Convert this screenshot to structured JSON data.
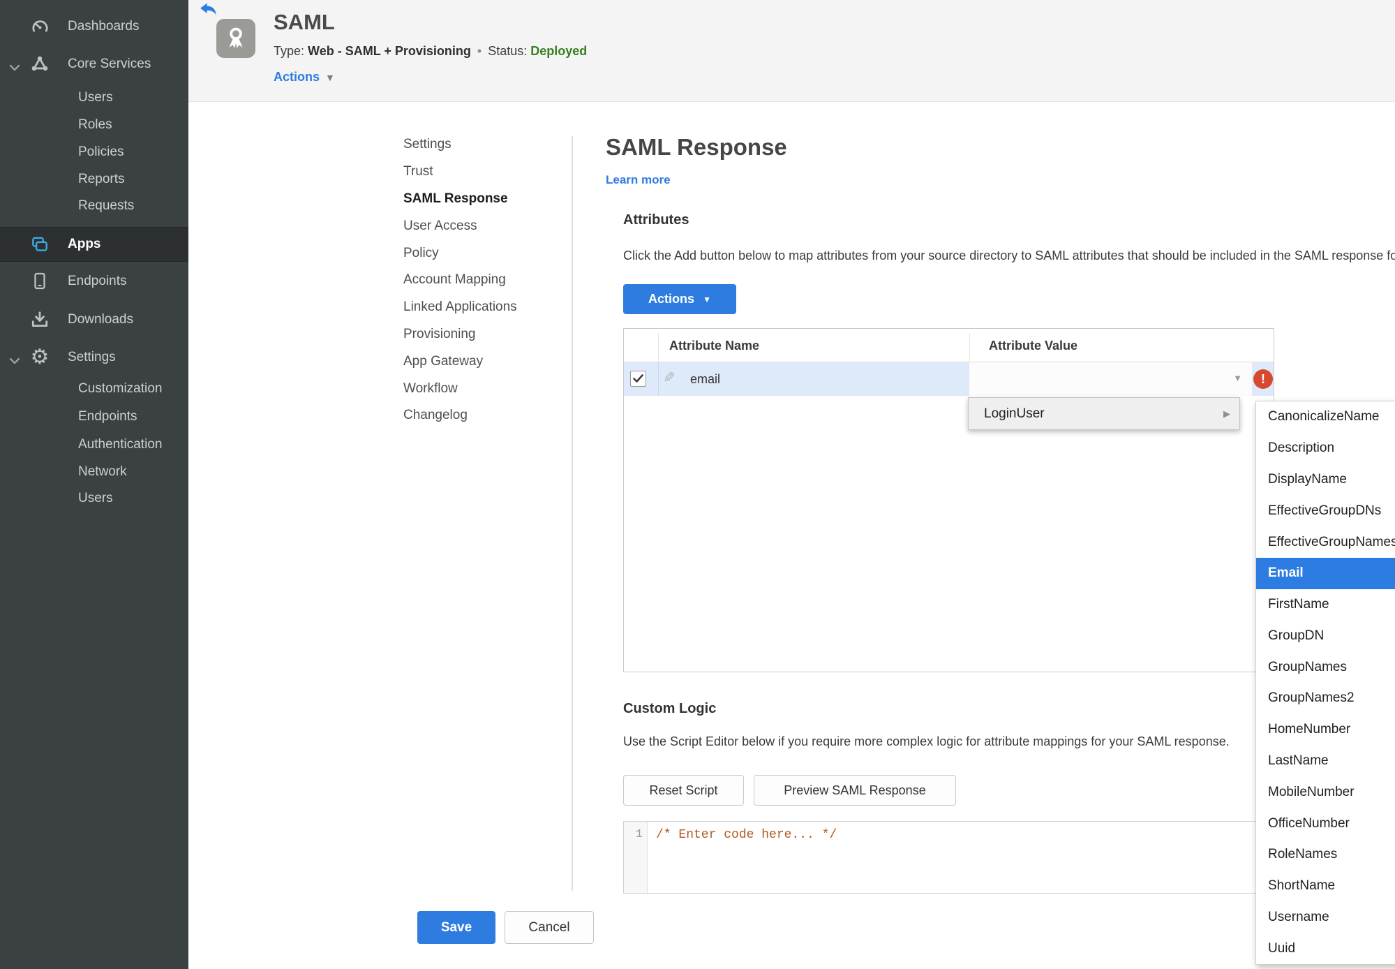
{
  "sidebar": {
    "dashboards": "Dashboards",
    "core_services": "Core Services",
    "core_children": [
      "Users",
      "Roles",
      "Policies",
      "Reports",
      "Requests"
    ],
    "apps": "Apps",
    "endpoints": "Endpoints",
    "downloads": "Downloads",
    "settings": "Settings",
    "settings_children": [
      "Customization",
      "Endpoints",
      "Authentication",
      "Network",
      "Users"
    ]
  },
  "header": {
    "title": "SAML",
    "type_label": "Type:",
    "type_value": "Web - SAML + Provisioning",
    "separator": "•",
    "status_label": "Status:",
    "status_value": "Deployed",
    "actions_label": "Actions"
  },
  "subnav": {
    "items": [
      "Settings",
      "Trust",
      "SAML Response",
      "User Access",
      "Policy",
      "Account Mapping",
      "Linked Applications",
      "Provisioning",
      "App Gateway",
      "Workflow",
      "Changelog"
    ],
    "active": "SAML Response"
  },
  "main": {
    "title": "SAML Response",
    "learn_more": "Learn more",
    "attributes": {
      "heading": "Attributes",
      "description": "Click the Add button below to map attributes from your source directory to SAML attributes that should be included in the SAML response for this application.",
      "actions_button": "Actions",
      "table": {
        "columns": [
          "Attribute Name",
          "Attribute Value"
        ],
        "row": {
          "name": "email",
          "value": "",
          "checked": true,
          "error": true
        }
      }
    },
    "custom_logic": {
      "heading": "Custom Logic",
      "description": "Use the Script Editor below if you require more complex logic for attribute mappings for your SAML response.",
      "reset_button": "Reset Script",
      "preview_button": "Preview SAML Response",
      "editor": {
        "line_number": "1",
        "code": "/* Enter code here... */"
      }
    },
    "save_button": "Save",
    "cancel_button": "Cancel"
  },
  "dropdown": {
    "parent_item": "LoginUser",
    "selected": "Email",
    "submenu": [
      "CanonicalizeName",
      "Description",
      "DisplayName",
      "EffectiveGroupDNs",
      "EffectiveGroupNames",
      "Email",
      "FirstName",
      "GroupDN",
      "GroupNames",
      "GroupNames2",
      "HomeNumber",
      "LastName",
      "MobileNumber",
      "OfficeNumber",
      "RoleNames",
      "ShortName",
      "Username",
      "Uuid"
    ],
    "submenu_arrow": "▶"
  },
  "icons": {
    "caret_down": "▼",
    "pencil": "✎",
    "bullet": "•",
    "error_mark": "!",
    "gear": "⚙"
  },
  "colors": {
    "accent_blue": "#2e7ce0",
    "status_green": "#37801f",
    "error_red": "#d7492f",
    "sidebar_bg": "#3b4043",
    "row_highlight": "#deeaf9",
    "selected_menu": "#2d7ce1",
    "code_orange": "#b05a1c"
  }
}
